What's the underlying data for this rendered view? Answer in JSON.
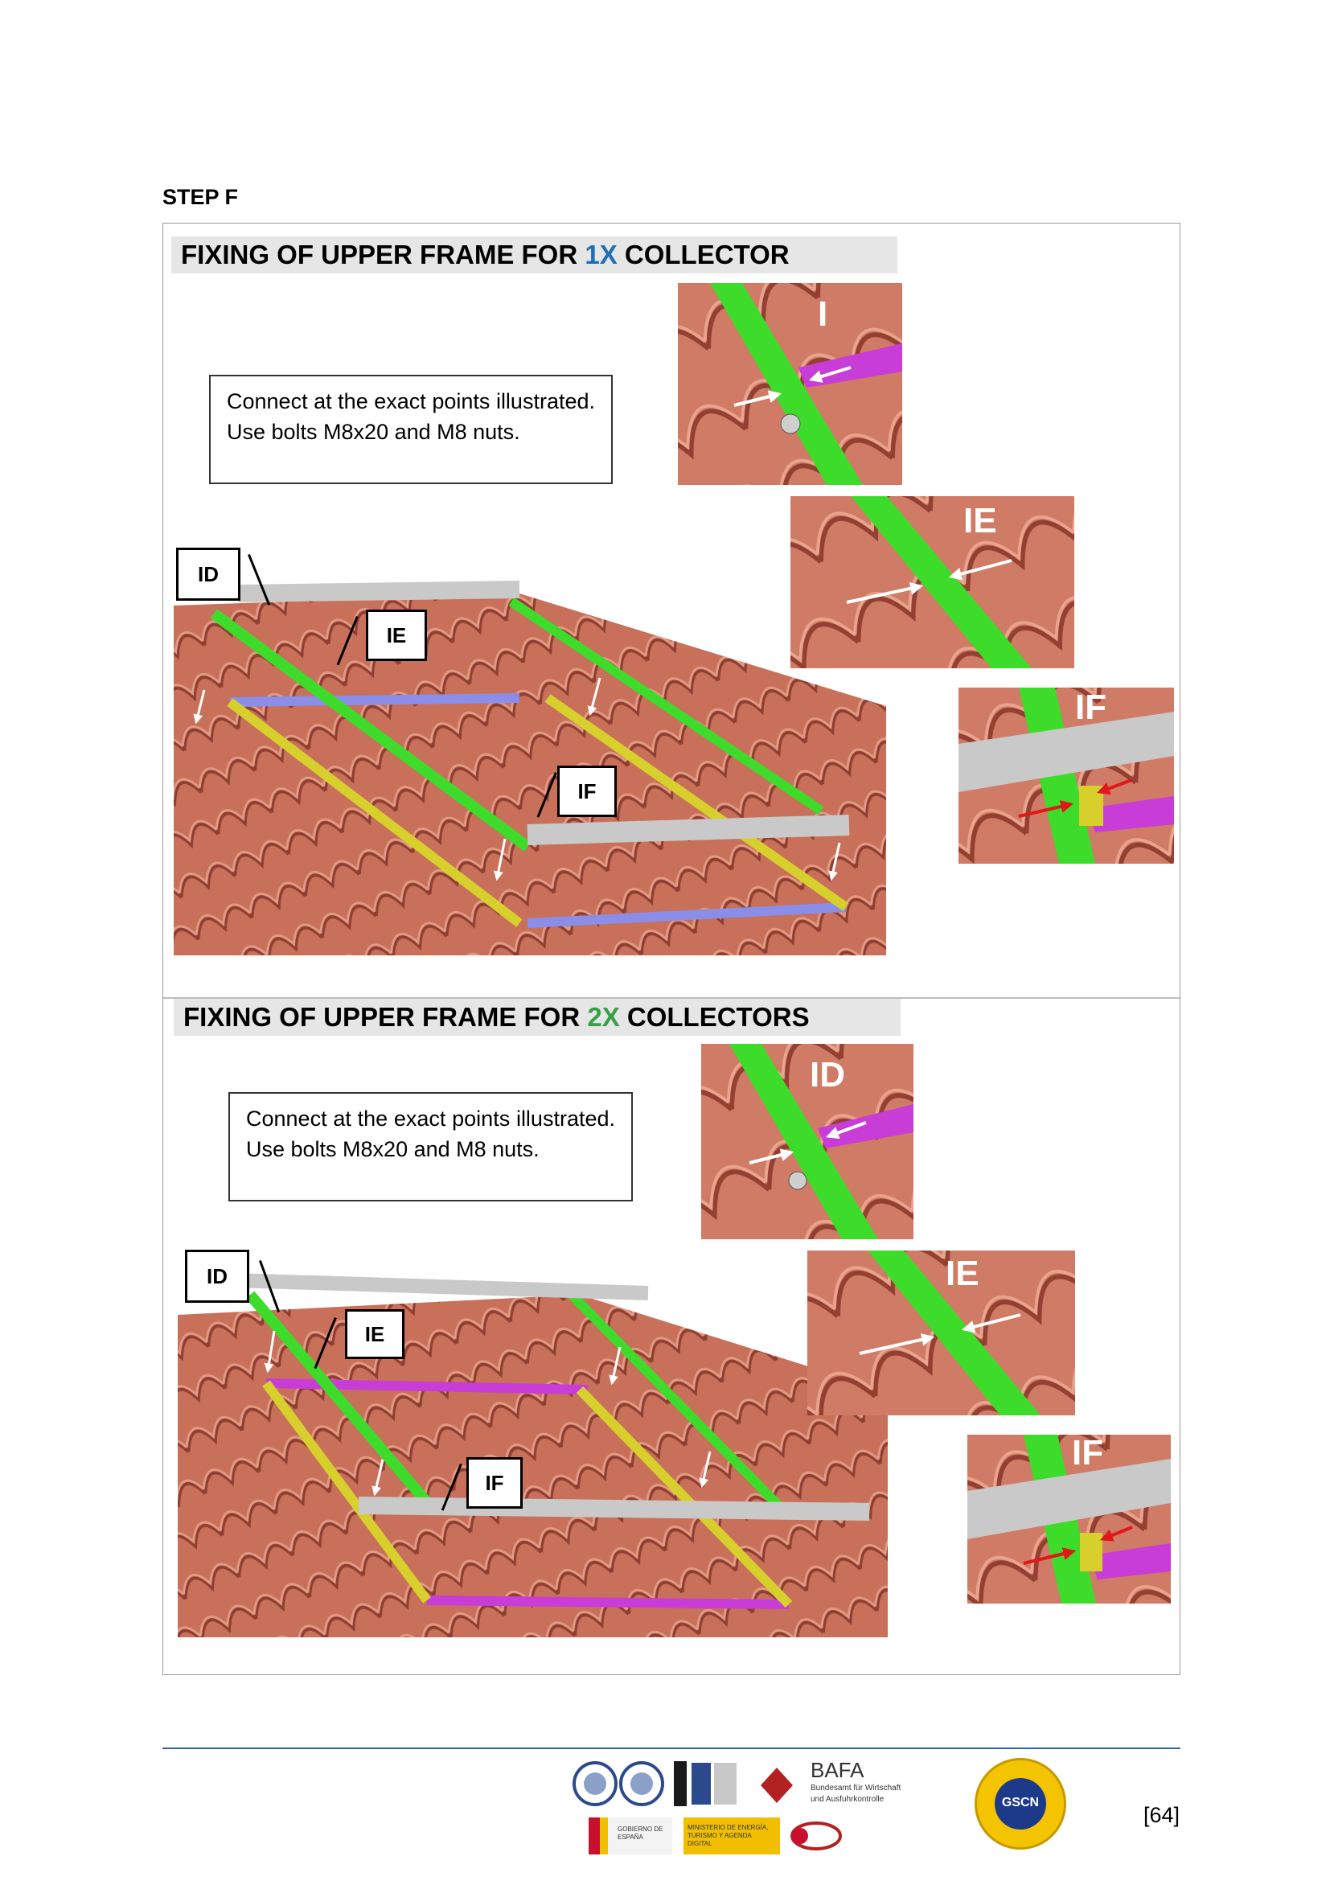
{
  "step": "STEP F",
  "sections": [
    {
      "title_pre": "FIXING OF UPPER FRAME FOR ",
      "title_hl": "1X",
      "title_post": " COLLECTOR",
      "note": "Connect at the exact points illustrated. Use bolts M8x20 and M8 nuts.",
      "callouts": [
        "ID",
        "IE",
        "IF"
      ],
      "photos": [
        "I",
        "IE",
        "IF"
      ]
    },
    {
      "title_pre": "FIXING OF UPPER FRAME FOR ",
      "title_hl": "2X",
      "title_post": " COLLECTORS",
      "note": "Connect at the exact points illustrated. Use bolts M8x20 and M8 nuts.",
      "callouts": [
        "ID",
        "IE",
        "IF"
      ],
      "photos": [
        "ID",
        "IE",
        "IF"
      ]
    }
  ],
  "footer": {
    "bafa_name": "BAFA",
    "bafa_sub1": "Bundesamt für Wirtschaft",
    "bafa_sub2": "und Ausfuhrkontrolle",
    "gscn": "GSCN",
    "gov_text": "GOBIERNO DE ESPAÑA",
    "ministry_text": "MINISTERIO DE ENERGÍA, TURISMO Y AGENDA DIGITAL"
  },
  "page_number": "[64]",
  "colors": {
    "tile": "#c8705a",
    "tile_dark": "#9a4536",
    "rail_green": "#3ddc2a",
    "rail_yellow": "#d6cf2c",
    "rail_blue": "#8a8ee8",
    "rail_magenta": "#c83cd8",
    "rail_grey": "#c9c9c9",
    "accent_1x": "#1f6fb5",
    "accent_2x": "#3aa046",
    "footer_line": "#2f5fbf"
  }
}
